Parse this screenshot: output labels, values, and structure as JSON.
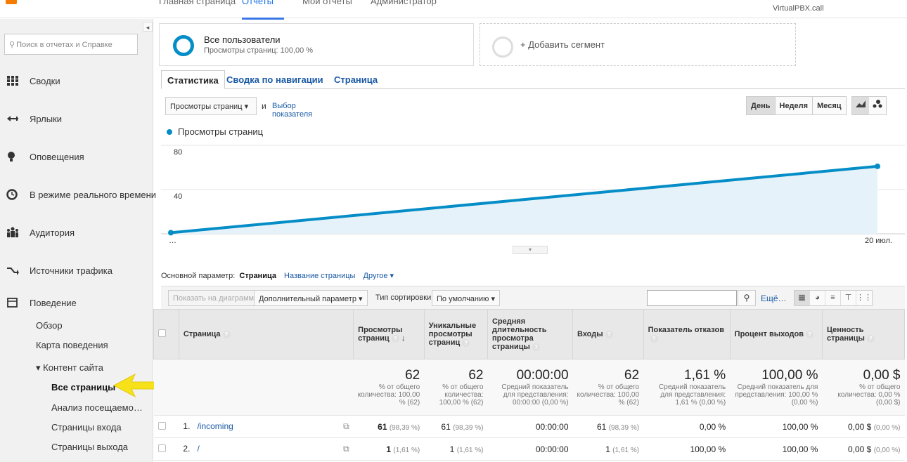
{
  "topbar": {
    "tabs": [
      "Главная страница",
      "Отчеты",
      "Мои отчеты",
      "Администратор"
    ],
    "account": "VirtualPBX.call"
  },
  "sidebar": {
    "search_placeholder": "Поиск в отчетах и Справке",
    "items": [
      {
        "label": "Сводки",
        "icon": "grid-icon"
      },
      {
        "label": "Ярлыки",
        "icon": "shortcut-arrow-icon"
      },
      {
        "label": "Оповещения",
        "icon": "lightbulb-icon"
      },
      {
        "label": "В режиме реального времени",
        "icon": "clock-icon"
      },
      {
        "label": "Аудитория",
        "icon": "people-icon"
      },
      {
        "label": "Источники трафика",
        "icon": "traffic-arrows-icon"
      },
      {
        "label": "Поведение",
        "icon": "behavior-window-icon"
      }
    ],
    "behavior_sub": {
      "overview": "Обзор",
      "behavior_map": "Карта поведения",
      "site_content": "▾ Контент сайта",
      "all_pages": "Все страницы",
      "content_drilldown": "Анализ посещаемо…",
      "landing_pages": "Страницы входа",
      "exit_pages": "Страницы выхода"
    }
  },
  "segments": {
    "active_title": "Все пользователи",
    "active_sub": "Просмотры страниц: 100,00 %",
    "add_label": "+ Добавить сегмент"
  },
  "report_tabs": [
    "Статистика",
    "Сводка по навигации",
    "Страница"
  ],
  "metric": {
    "dropdown": "Просмотры страниц",
    "and": "и",
    "choose": "Выбор показателя"
  },
  "period_buttons": [
    "День",
    "Неделя",
    "Месяц"
  ],
  "chart_data": {
    "type": "line",
    "series": [
      {
        "name": "Просмотры страниц",
        "values": [
          1,
          61
        ]
      }
    ],
    "x": [
      "…",
      "20 июл."
    ],
    "ylim": [
      0,
      80
    ],
    "yticks": [
      "80",
      "40"
    ],
    "color": "#058dc7",
    "legend": "top-left",
    "grid": true
  },
  "dimension": {
    "label": "Основной параметр:",
    "current": "Страница",
    "alt": "Название страницы",
    "other": "Другое ▾"
  },
  "toolbar": {
    "plot_rows": "Показать на диаграмме",
    "secondary": "Дополнительный параметр ▾",
    "sort_label": "Тип сортировки:",
    "sort_value": "По умолчанию ▾",
    "more": "Ещё…"
  },
  "table": {
    "headers": {
      "page": "Страница",
      "pageviews": "Просмотры страниц",
      "unique": "Уникальные просмотры страниц",
      "avg_time": "Средняя длительность просмотра страницы",
      "entrances": "Входы",
      "bounce": "Показатель отказов",
      "exit": "Процент выходов",
      "value": "Ценность страницы"
    },
    "totals": {
      "pageviews": "62",
      "pageviews_sub": "% от общего количества: 100,00 % (62)",
      "unique": "62",
      "unique_sub": "% от общего количества: 100,00 % (62)",
      "avg_time": "00:00:00",
      "avg_time_sub": "Средний показатель для представления: 00:00:00 (0,00 %)",
      "entrances": "62",
      "entrances_sub": "% от общего количества: 100,00 % (62)",
      "bounce": "1,61 %",
      "bounce_sub": "Средний показатель для представления: 1,61 % (0,00 %)",
      "exit": "100,00 %",
      "exit_sub": "Средний показатель для представления: 100,00 % (0,00 %)",
      "value": "0,00 $",
      "value_sub": "% от общего количества: 0,00 % (0,00 $)"
    },
    "rows": [
      {
        "n": "1.",
        "page": "/incoming",
        "pageviews": "61",
        "pageviews_pct": "(98,39 %)",
        "unique": "61",
        "unique_pct": "(98,39 %)",
        "avg_time": "00:00:00",
        "entrances": "61",
        "entrances_pct": "(98,39 %)",
        "bounce": "0,00 %",
        "exit": "100,00 %",
        "value": "0,00 $",
        "value_pct": "(0,00 %)"
      },
      {
        "n": "2.",
        "page": "/",
        "pageviews": "1",
        "pageviews_pct": "(1,61 %)",
        "unique": "1",
        "unique_pct": "(1,61 %)",
        "avg_time": "00:00:00",
        "entrances": "1",
        "entrances_pct": "(1,61 %)",
        "bounce": "100,00 %",
        "exit": "100,00 %",
        "value": "0,00 $",
        "value_pct": "(0,00 %)"
      }
    ]
  }
}
